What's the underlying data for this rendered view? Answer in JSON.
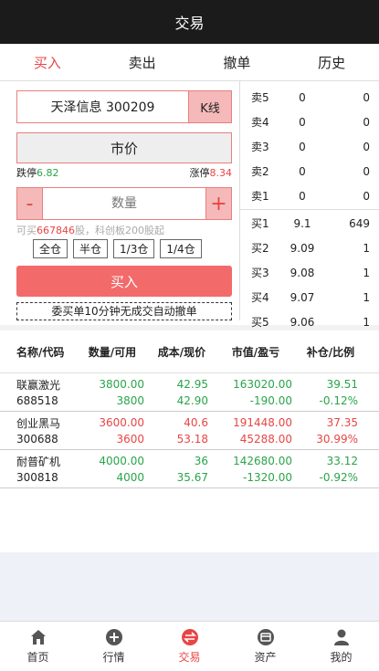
{
  "header": {
    "title": "交易"
  },
  "tabs": [
    {
      "label": "买入",
      "active": true
    },
    {
      "label": "卖出",
      "active": false
    },
    {
      "label": "撤单",
      "active": false
    },
    {
      "label": "历史",
      "active": false
    }
  ],
  "trade": {
    "stock_name": "天泽信息 300209",
    "kline_label": "K线",
    "price_type": "市价",
    "limit_down_label": "跌停",
    "limit_down_value": "6.82",
    "limit_up_label": "涨停",
    "limit_up_value": "8.34",
    "minus_label": "-",
    "plus_label": "+",
    "qty_placeholder": "数量",
    "avail_prefix": "可买",
    "avail_value": "667846",
    "avail_suffix": "股，科创板200股起",
    "portions": [
      "全仓",
      "半仓",
      "1/3仓",
      "1/4仓"
    ],
    "buy_label": "买入",
    "notice": "委买单10分钟无成交自动撤单"
  },
  "order_book": {
    "asks": [
      {
        "label": "卖5",
        "price": "0",
        "vol": "0"
      },
      {
        "label": "卖4",
        "price": "0",
        "vol": "0"
      },
      {
        "label": "卖3",
        "price": "0",
        "vol": "0"
      },
      {
        "label": "卖2",
        "price": "0",
        "vol": "0"
      },
      {
        "label": "卖1",
        "price": "0",
        "vol": "0"
      }
    ],
    "bids": [
      {
        "label": "买1",
        "price": "9.1",
        "vol": "649"
      },
      {
        "label": "买2",
        "price": "9.09",
        "vol": "1"
      },
      {
        "label": "买3",
        "price": "9.08",
        "vol": "1"
      },
      {
        "label": "买4",
        "price": "9.07",
        "vol": "1"
      },
      {
        "label": "买5",
        "price": "9.06",
        "vol": "1"
      }
    ]
  },
  "positions": {
    "headers": [
      "名称/代码",
      "数量/可用",
      "成本/现价",
      "市值/盈亏",
      "补仓/比例"
    ],
    "rows": [
      {
        "name": "联赢激光",
        "code": "688518",
        "qty": "3800.00",
        "avail": "3800",
        "cost": "42.95",
        "price": "42.90",
        "value": "163020.00",
        "pnl": "-190.00",
        "add": "39.51",
        "ratio": "-0.12%",
        "color": "green"
      },
      {
        "name": "创业黑马",
        "code": "300688",
        "qty": "3600.00",
        "avail": "3600",
        "cost": "40.6",
        "price": "53.18",
        "value": "191448.00",
        "pnl": "45288.00",
        "add": "37.35",
        "ratio": "30.99%",
        "color": "red"
      },
      {
        "name": "耐普矿机",
        "code": "300818",
        "qty": "4000.00",
        "avail": "4000",
        "cost": "36",
        "price": "35.67",
        "value": "142680.00",
        "pnl": "-1320.00",
        "add": "33.12",
        "ratio": "-0.92%",
        "color": "green"
      }
    ]
  },
  "nav": [
    {
      "label": "首页",
      "icon": "home-icon",
      "active": false
    },
    {
      "label": "行情",
      "icon": "plus-circle-icon",
      "active": false
    },
    {
      "label": "交易",
      "icon": "trade-icon",
      "active": true
    },
    {
      "label": "资产",
      "icon": "wallet-icon",
      "active": false
    },
    {
      "label": "我的",
      "icon": "user-icon",
      "active": false
    }
  ],
  "colors": {
    "accent": "#e84545",
    "up": "#e84545",
    "down": "#2aa44a"
  }
}
